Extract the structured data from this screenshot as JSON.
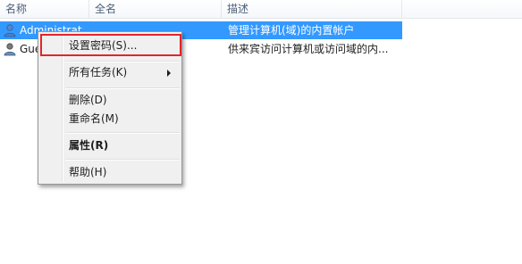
{
  "columns": {
    "name": "名称",
    "fullname": "全名",
    "description": "描述"
  },
  "rows": [
    {
      "name": "Administrat",
      "fullname": "",
      "description": "管理计算机(域)的内置帐户",
      "icon": "user-icon",
      "selected": true
    },
    {
      "name": "Gue",
      "fullname": "",
      "description": "供来宾访问计算机或访问域的内...",
      "icon": "guest-user-icon",
      "selected": false
    }
  ],
  "context_menu": {
    "set_password": "设置密码(S)...",
    "all_tasks": "所有任务(K)",
    "delete": "删除(D)",
    "rename": "重命名(M)",
    "properties": "属性(R)",
    "help": "帮助(H)"
  },
  "colors": {
    "selection": "#3399ff",
    "highlight_box": "#e0262b",
    "menu_bg": "#f0f0f0"
  }
}
